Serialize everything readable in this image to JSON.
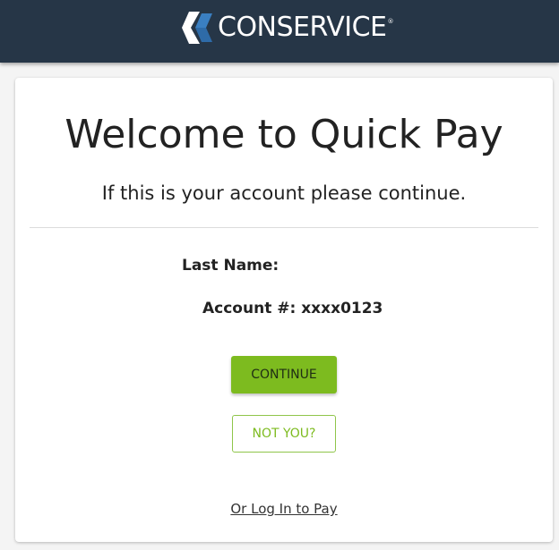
{
  "header": {
    "brand_name": "CONSERVICE",
    "brand_mark": "®",
    "logo_icon": "conservice-chevron-logo-icon",
    "background_color": "#263647",
    "logo_colors": [
      "#ffffff",
      "#3a7fc1"
    ]
  },
  "main": {
    "title": "Welcome to Quick Pay",
    "subtitle": "If this is your account please continue.",
    "last_name_label": "Last Name:",
    "account_label": "Account #: xxxx0123",
    "continue_label": "CONTINUE",
    "not_you_label": "NOT YOU?",
    "login_link_label": "Or Log In to Pay",
    "accent_color": "#7dbb1f"
  }
}
